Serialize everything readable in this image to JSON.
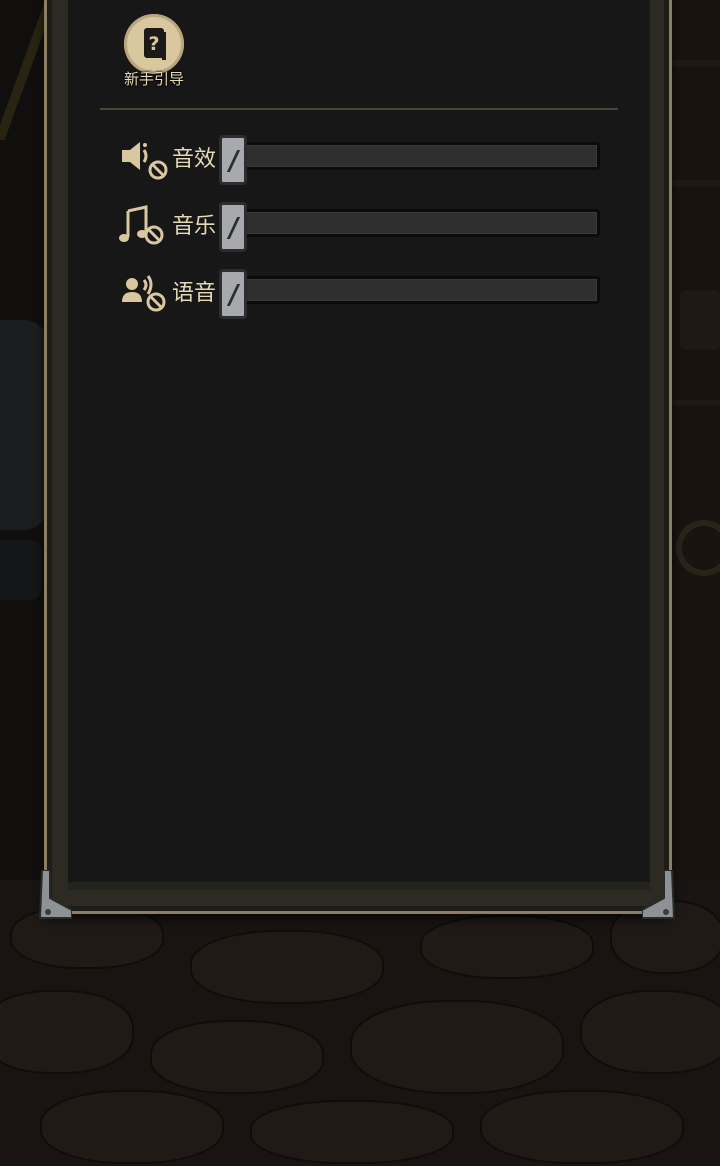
{
  "panel": {
    "guide_button": {
      "label": "新手引导",
      "icon": "question-book-icon"
    }
  },
  "audio_settings": [
    {
      "key": "sfx",
      "label": "音效",
      "icon": "speaker-muted-icon",
      "volume_percent": 0,
      "muted": true
    },
    {
      "key": "music",
      "label": "音乐",
      "icon": "music-note-muted-icon",
      "volume_percent": 0,
      "muted": true
    },
    {
      "key": "voice",
      "label": "语音",
      "icon": "voice-muted-icon",
      "volume_percent": 0,
      "muted": true
    }
  ],
  "colors": {
    "panel_bg": "#171717",
    "frame": "#8a7e63",
    "label": "#e6d9b8",
    "icon": "#d9c7a0",
    "track": "#2f2f2f",
    "knob": "#a7a9ad"
  }
}
